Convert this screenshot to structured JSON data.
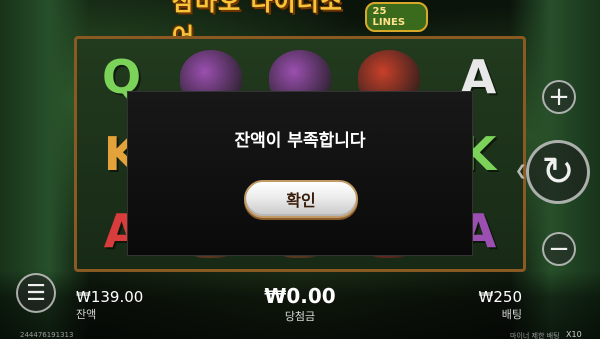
{
  "game": {
    "title": "잠바오 다이너소어",
    "badge": "25 LINES"
  },
  "reels": {
    "symbols": [
      {
        "glyph": "Q",
        "color": "#7cd35a"
      },
      {
        "glyph": "",
        "color": "#9b4fb0"
      },
      {
        "glyph": "",
        "color": "#9b4fb0"
      },
      {
        "glyph": "",
        "color": "#c8402a"
      },
      {
        "glyph": "A",
        "color": "#e8e8e8"
      },
      {
        "glyph": "K",
        "color": "#e3a23a"
      },
      {
        "glyph": "",
        "color": "#2a4a22"
      },
      {
        "glyph": "",
        "color": "#2a4a22"
      },
      {
        "glyph": "",
        "color": "#2a4a22"
      },
      {
        "glyph": "K",
        "color": "#7cd35a"
      },
      {
        "glyph": "A",
        "color": "#d83c3c"
      },
      {
        "glyph": "",
        "color": "#c76a2a"
      },
      {
        "glyph": "",
        "color": "#c76a2a"
      },
      {
        "glyph": "",
        "color": "#c8402a"
      },
      {
        "glyph": "A",
        "color": "#9b4fb0"
      }
    ]
  },
  "modal": {
    "message": "잔액이 부족합니다",
    "confirm_label": "확인"
  },
  "controls": {
    "plus": "+",
    "minus": "−",
    "spin": "↻",
    "menu": "☰",
    "arrow": "❮"
  },
  "stats": {
    "balance_value": "₩139.00",
    "balance_label": "잔액",
    "win_value": "₩0.00",
    "win_label": "당첨금",
    "bet_value": "₩250",
    "bet_label": "배팅"
  },
  "footer": {
    "round_id": "244476191313",
    "right_text": "마이너 제한 배팅",
    "multiplier": "X10"
  }
}
